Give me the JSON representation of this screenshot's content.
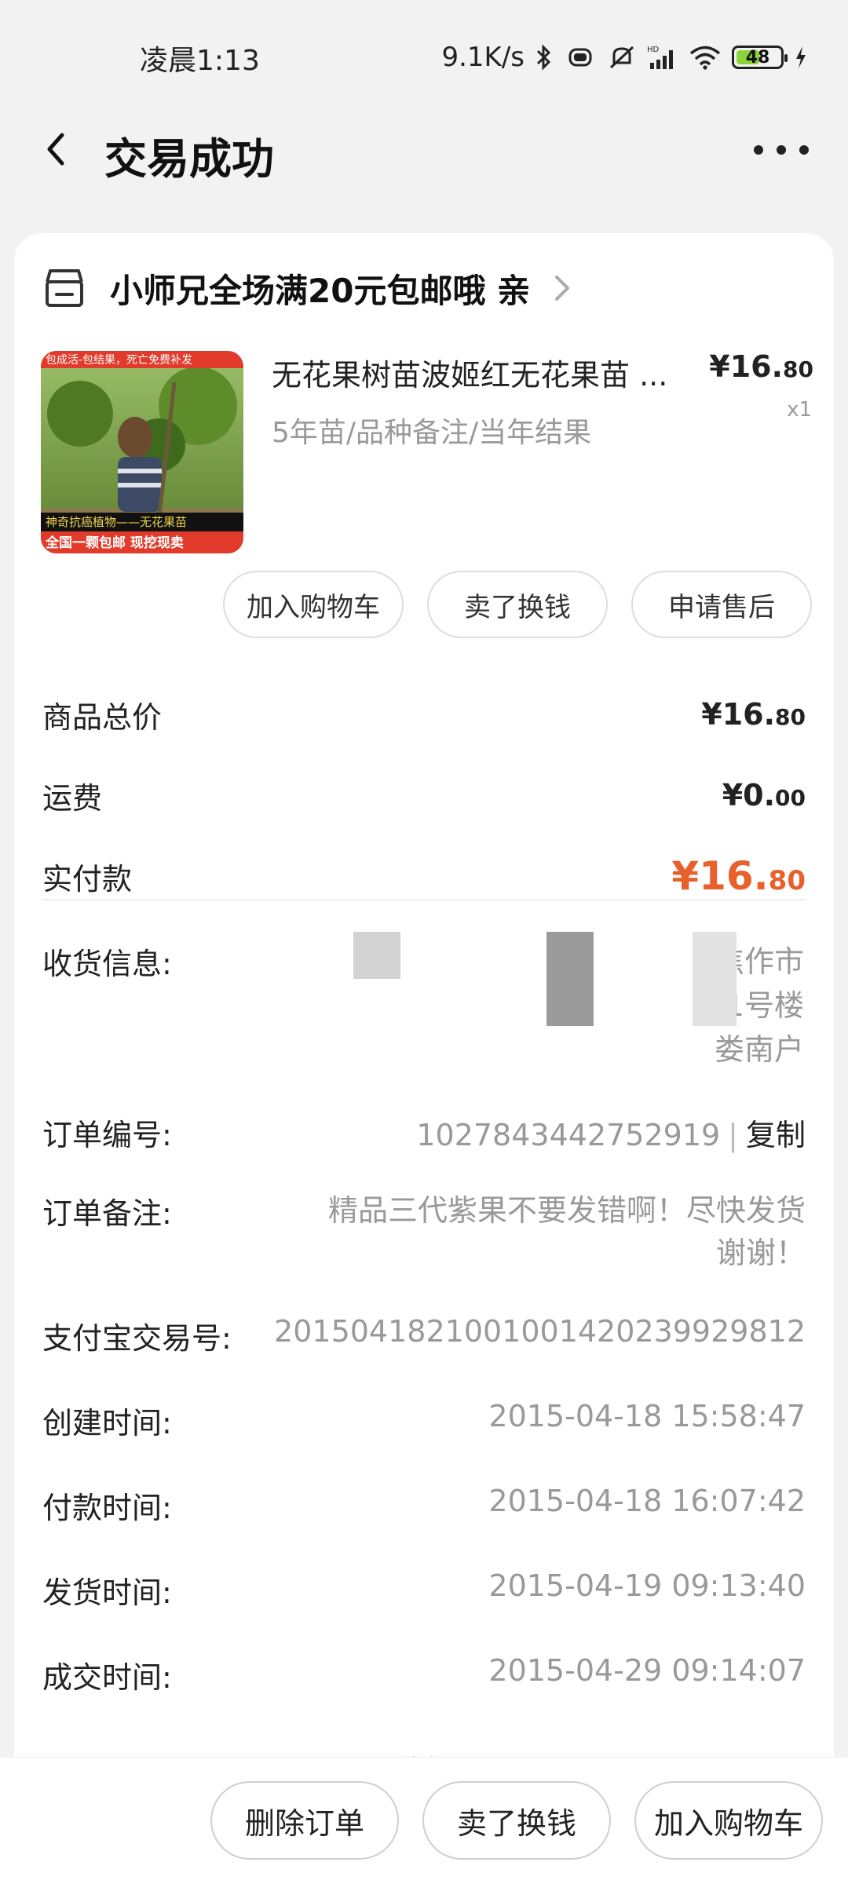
{
  "status_bar": {
    "time": "凌晨1:13",
    "net_speed": "9.1K/s",
    "battery": "48"
  },
  "header": {
    "title": "交易成功"
  },
  "shop": {
    "name": "小师兄全场满20元包邮哦 亲"
  },
  "product": {
    "title": "无花果树苗波姬红无花果苗 ...",
    "spec": "5年苗/品种备注/当年结果",
    "price_int": "¥16.",
    "price_dec": "80",
    "qty": "x1",
    "image_caption_top": "包成活-包结果，死亡免费补发",
    "image_caption_mid": "神奇抗癌植物——无花果苗",
    "image_caption_bottom": "全国一颗包邮  现挖现卖"
  },
  "actions": {
    "add_cart": "加入购物车",
    "resell": "卖了换钱",
    "after_sale": "申请售后"
  },
  "summary": {
    "total_label": "商品总价",
    "total_int": "¥16.",
    "total_dec": "80",
    "shipping_label": "运费",
    "shipping_int": "¥0.",
    "shipping_dec": "00",
    "paid_label": "实付款",
    "paid_int": "¥16.",
    "paid_dec": "80"
  },
  "address": {
    "label": "收货信息:",
    "line1": "焦作市",
    "line2": "1号楼",
    "line3": "娄南户"
  },
  "order": {
    "id_label": "订单编号:",
    "id_value": "1027843442752919",
    "copy": "复制",
    "note_label": "订单备注:",
    "note_value": "精品三代紫果不要发错啊！尽快发货谢谢！",
    "alipay_label": "支付宝交易号:",
    "alipay_value": "2015041821001001420239929812",
    "created_label": "创建时间:",
    "created_value": "2015-04-18 15:58:47",
    "paid_label": "付款时间:",
    "paid_value": "2015-04-18 16:07:42",
    "shipped_label": "发货时间:",
    "shipped_value": "2015-04-19 09:13:40",
    "closed_label": "成交时间:",
    "closed_value": "2015-04-29 09:14:07",
    "collapse": "收起"
  },
  "bottom": {
    "delete": "删除订单",
    "resell": "卖了换钱",
    "add_cart": "加入购物车"
  },
  "colors": {
    "accent_price": "#e8602c",
    "background": "#f2f2f2"
  }
}
